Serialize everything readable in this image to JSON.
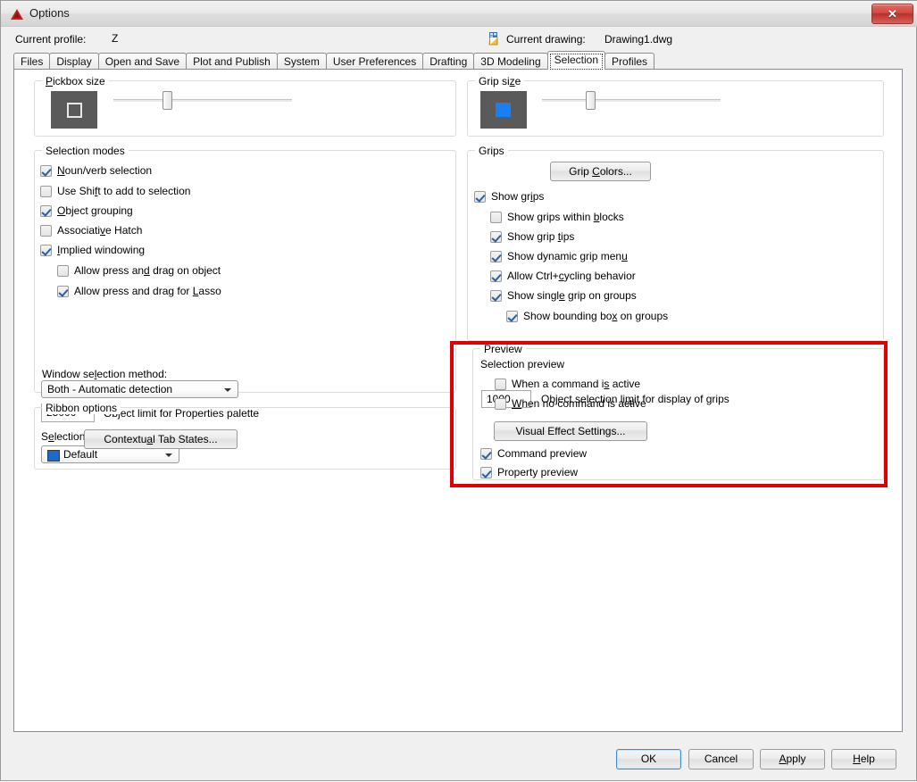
{
  "window": {
    "title": "Options",
    "icon": "autocad-triangle-icon",
    "close_label": "✕"
  },
  "header": {
    "profile_label": "Current profile:",
    "profile_value": "Z",
    "drawing_icon": "drawing-file-icon",
    "drawing_label": "Current drawing:",
    "drawing_value": "Drawing1.dwg"
  },
  "tabs": [
    {
      "label": "Files",
      "active": false
    },
    {
      "label": "Display",
      "active": false
    },
    {
      "label": "Open and Save",
      "active": false
    },
    {
      "label": "Plot and Publish",
      "active": false
    },
    {
      "label": "System",
      "active": false
    },
    {
      "label": "User Preferences",
      "active": false
    },
    {
      "label": "Drafting",
      "active": false
    },
    {
      "label": "3D Modeling",
      "active": false
    },
    {
      "label": "Selection",
      "active": true
    },
    {
      "label": "Profiles",
      "active": false
    }
  ],
  "pickbox": {
    "legend": "Pickbox size",
    "legend_mnemonic": "P",
    "slider_value_pct": 30
  },
  "gripsize": {
    "legend": "Grip size",
    "legend_mnemonic": "z",
    "slider_value_pct": 27
  },
  "selection_modes": {
    "legend": "Selection modes",
    "items": [
      {
        "label": "Noun/verb selection",
        "checked": true,
        "indent": 0,
        "mnemonic": "N"
      },
      {
        "label": "Use Shift to add to selection",
        "checked": false,
        "indent": 0,
        "mnemonic": "f"
      },
      {
        "label": "Object grouping",
        "checked": true,
        "indent": 0,
        "mnemonic": "O"
      },
      {
        "label": "Associative Hatch",
        "checked": false,
        "indent": 0,
        "mnemonic": "v"
      },
      {
        "label": "Implied windowing",
        "checked": true,
        "indent": 0,
        "mnemonic": "I"
      },
      {
        "label": "Allow press and drag on object",
        "checked": false,
        "indent": 1,
        "mnemonic": "d"
      },
      {
        "label": "Allow press and drag for Lasso",
        "checked": true,
        "indent": 1,
        "mnemonic": "L"
      }
    ],
    "window_method_label": "Window selection method:",
    "window_method_value": "Both - Automatic detection",
    "object_limit_value": "25000",
    "object_limit_label": "Object limit for Properties palette",
    "effect_color_label": "Selection effect color:",
    "effect_color_value": "Default",
    "effect_color_hex": "#1a6ad4"
  },
  "ribbon_options": {
    "legend": "Ribbon options",
    "button_label": "Contextual Tab States..."
  },
  "grips": {
    "legend": "Grips",
    "grip_colors_button": "Grip Colors...",
    "items": [
      {
        "label": "Show grips",
        "checked": true,
        "indent": 0,
        "mnemonic": "i"
      },
      {
        "label": "Show grips within blocks",
        "checked": false,
        "indent": 1,
        "mnemonic": "b"
      },
      {
        "label": "Show grip tips",
        "checked": true,
        "indent": 1,
        "mnemonic": "t"
      },
      {
        "label": "Show dynamic grip menu",
        "checked": true,
        "indent": 1,
        "mnemonic": "u"
      },
      {
        "label": "Allow Ctrl+cycling behavior",
        "checked": true,
        "indent": 1,
        "mnemonic": "c"
      },
      {
        "label": "Show single grip on groups",
        "checked": true,
        "indent": 1,
        "mnemonic": "e"
      },
      {
        "label": "Show bounding box on groups",
        "checked": true,
        "indent": 2,
        "mnemonic": "x"
      }
    ],
    "grip_limit_value": "1000",
    "grip_limit_label": "Object selection limit for display of grips"
  },
  "preview": {
    "legend": "Preview",
    "subheading": "Selection preview",
    "items": [
      {
        "label": "When a command is active",
        "checked": false,
        "mnemonic": "s"
      },
      {
        "label": "When no command is active",
        "checked": false,
        "mnemonic": "W"
      }
    ],
    "visual_effect_button": "Visual Effect Settings...",
    "items2": [
      {
        "label": "Command preview",
        "checked": true
      },
      {
        "label": "Property preview",
        "checked": true
      }
    ]
  },
  "annotation": {
    "color": "#e00000",
    "target": "preview-group"
  },
  "footer": {
    "buttons": [
      {
        "label": "OK",
        "default": true,
        "mnemonic": ""
      },
      {
        "label": "Cancel",
        "default": false,
        "mnemonic": ""
      },
      {
        "label": "Apply",
        "default": false,
        "mnemonic": "A"
      },
      {
        "label": "Help",
        "default": false,
        "mnemonic": "H"
      }
    ]
  }
}
